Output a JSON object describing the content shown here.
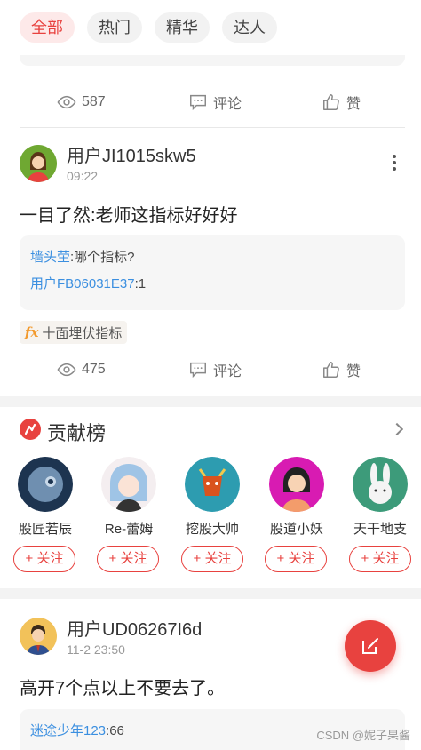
{
  "tabs": [
    {
      "label": "全部",
      "active": true
    },
    {
      "label": "热门",
      "active": false
    },
    {
      "label": "精华",
      "active": false
    },
    {
      "label": "达人",
      "active": false
    }
  ],
  "post1": {
    "views": "587",
    "comment_label": "评论",
    "like_label": "赞"
  },
  "post2": {
    "username": "用户JI1015skw5",
    "time": "09:22",
    "text": "一目了然:老师这指标好好好",
    "replies": [
      {
        "who": "墙头茔",
        "text": ":哪个指标?"
      },
      {
        "who": "用户FB06031E37",
        "text": ":1"
      }
    ],
    "tag_label": "十面埋伏指标",
    "tag_icon": "fx",
    "views": "475",
    "comment_label": "评论",
    "like_label": "赞"
  },
  "ranking": {
    "title": "贡献榜",
    "experts": [
      {
        "name": "股匠若辰",
        "follow": "+ 关注"
      },
      {
        "name": "Re-蕾姆",
        "follow": "+ 关注"
      },
      {
        "name": "挖股大帅",
        "follow": "+ 关注"
      },
      {
        "name": "股道小妖",
        "follow": "+ 关注"
      },
      {
        "name": "天干地支",
        "follow": "+ 关注"
      }
    ]
  },
  "post3": {
    "username": "用户UD06267I6d",
    "time": "11-2 23:50",
    "text": "高开7个点以上不要去了。",
    "replies": [
      {
        "who": "迷途少年123",
        "text": ":66"
      }
    ]
  },
  "watermark": "CSDN @妮子果酱",
  "colors": {
    "accent": "#e8423f",
    "link": "#3b8fe0"
  }
}
